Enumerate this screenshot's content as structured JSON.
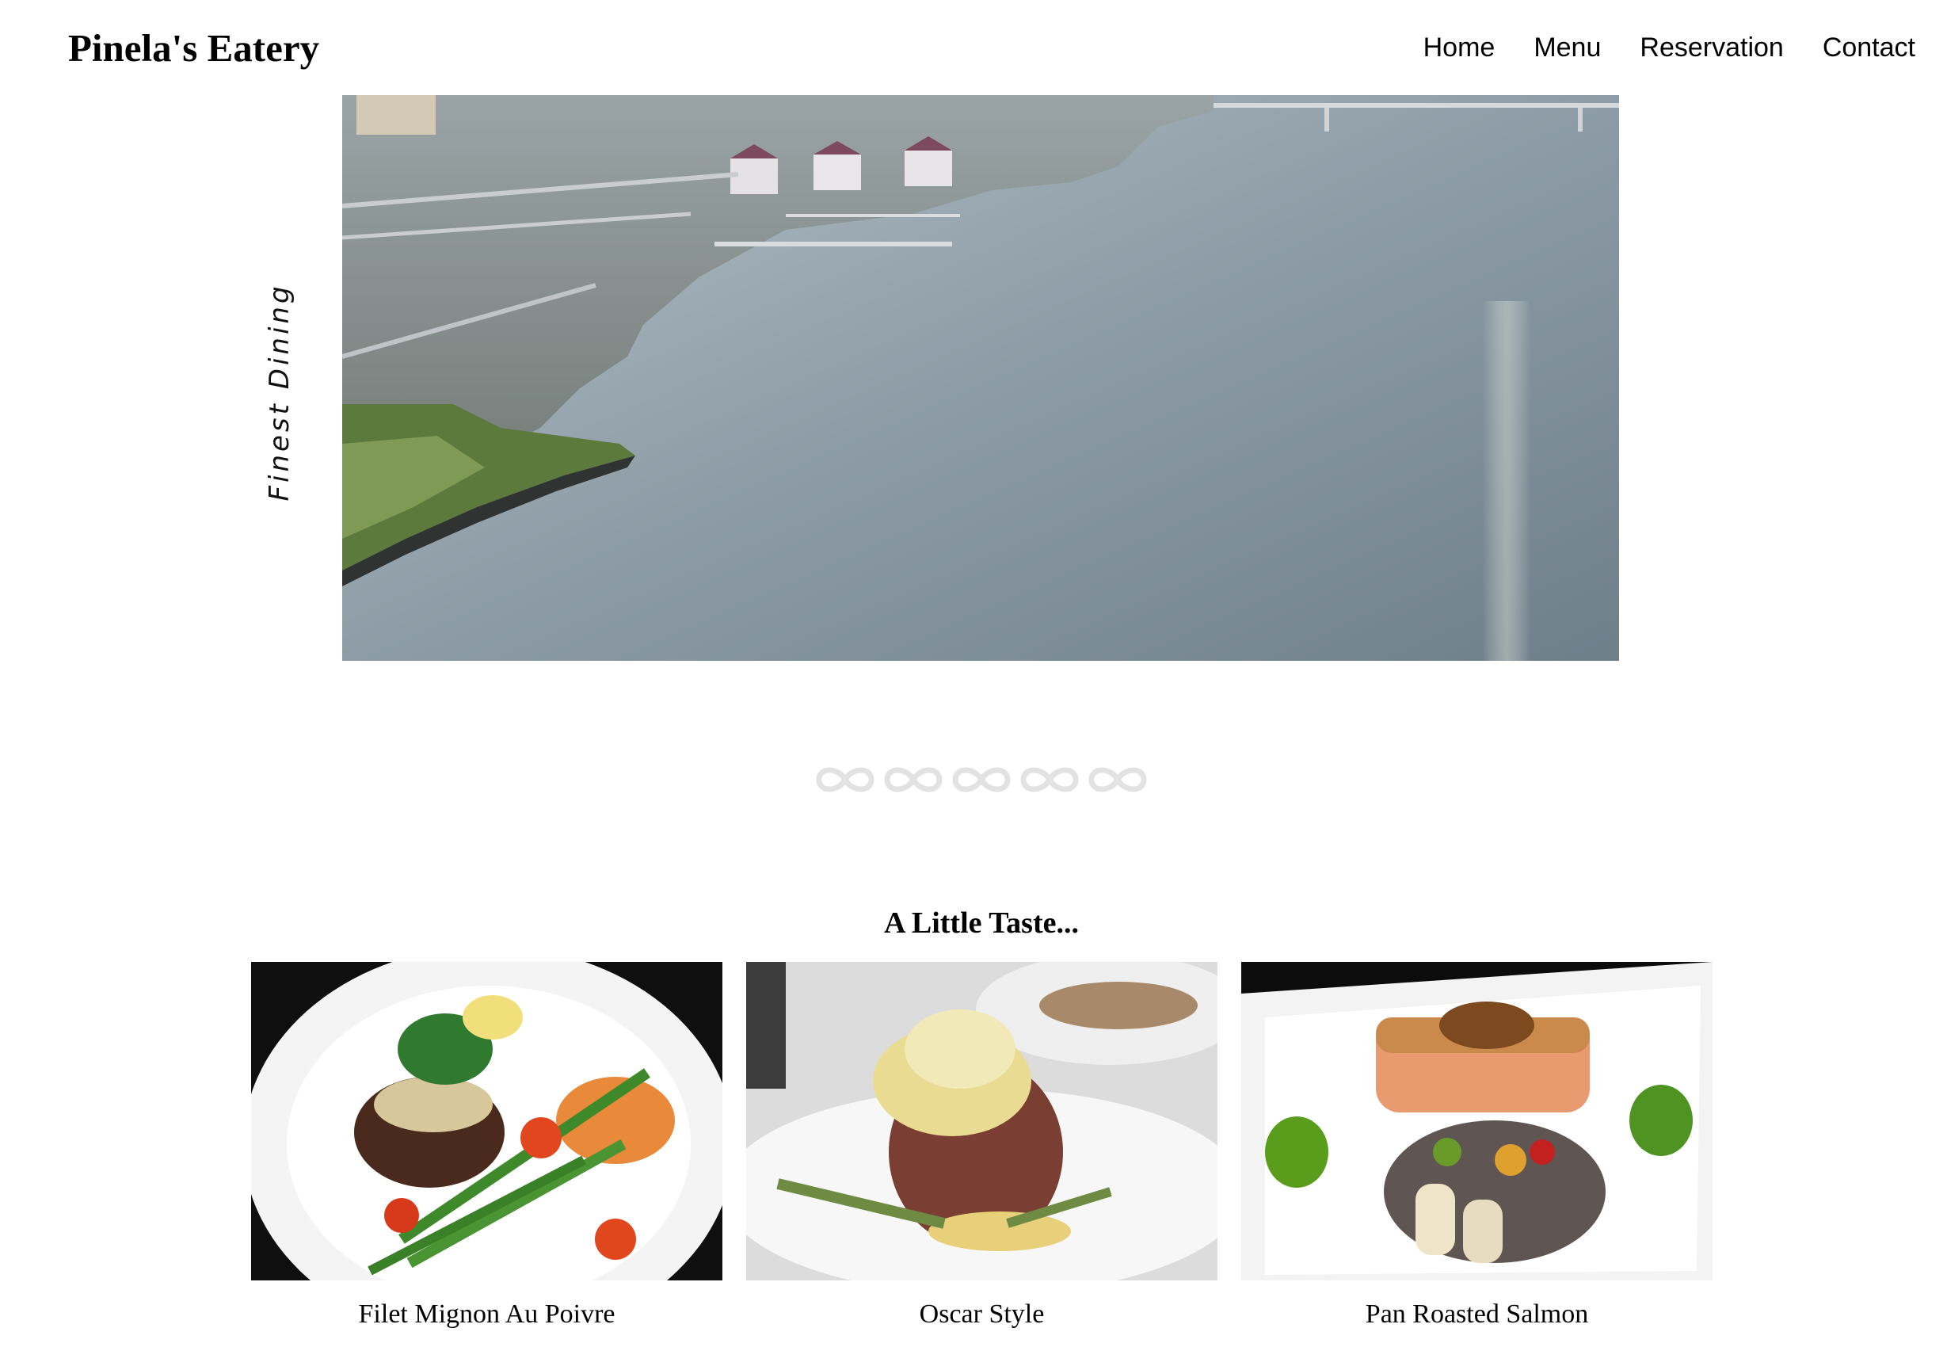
{
  "brand": {
    "name": "Pinela's Eatery"
  },
  "nav": {
    "items": [
      {
        "label": "Home"
      },
      {
        "label": "Menu"
      },
      {
        "label": "Reservation"
      },
      {
        "label": "Contact"
      }
    ]
  },
  "hero": {
    "side_label": "Finest Dining",
    "image": "aerial-harbor-photo"
  },
  "carousel": {
    "slide_count": 5,
    "indicator_icon": "infinity-icon",
    "indicator_color": "#e2e2e2"
  },
  "tasting": {
    "title": "A Little Taste...",
    "dishes": [
      {
        "name": "Filet Mignon Au Poivre",
        "image": "filet-mignon-photo"
      },
      {
        "name": "Oscar Style",
        "image": "oscar-style-photo"
      },
      {
        "name": "Pan Roasted Salmon",
        "image": "salmon-photo"
      }
    ]
  },
  "colors": {
    "background": "#ffffff",
    "text": "#000000",
    "water": "#8d9ca6"
  }
}
